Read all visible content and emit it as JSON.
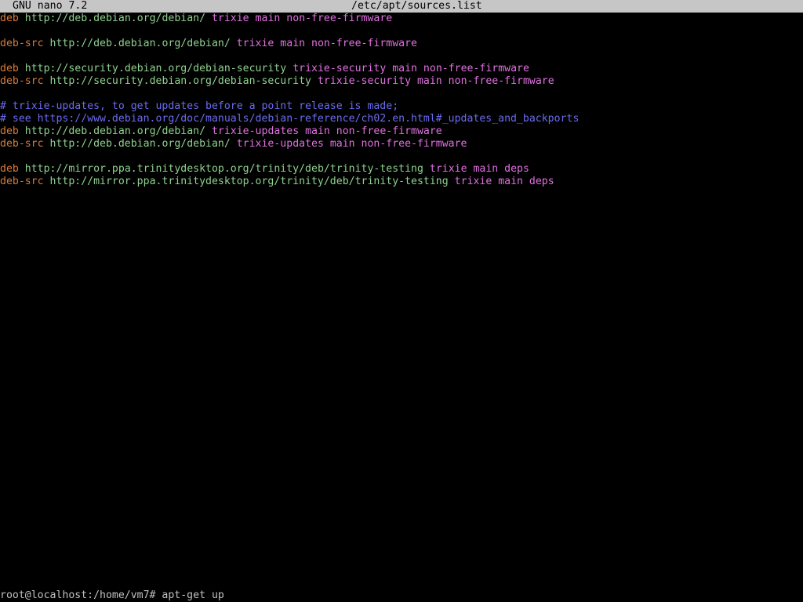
{
  "title_bar": {
    "app": "GNU nano 7.2",
    "file": "/etc/apt/sources.list"
  },
  "colors": {
    "keyword": "#d97a3a",
    "url": "#8fd18f",
    "suite": "#e070e0",
    "comment": "#6b6bf0",
    "background": "#000000",
    "title_bg": "#c6c6c6"
  },
  "lines": [
    {
      "type": "entry",
      "kw": "deb",
      "url": "http://deb.debian.org/debian/",
      "rest": "trixie main non-free-firmware"
    },
    {
      "type": "blank"
    },
    {
      "type": "entry",
      "kw": "deb-src",
      "url": "http://deb.debian.org/debian/",
      "rest": "trixie main non-free-firmware"
    },
    {
      "type": "blank"
    },
    {
      "type": "entry",
      "kw": "deb",
      "url": "http://security.debian.org/debian-security",
      "rest": "trixie-security main non-free-firmware"
    },
    {
      "type": "entry",
      "kw": "deb-src",
      "url": "http://security.debian.org/debian-security",
      "rest": "trixie-security main non-free-firmware"
    },
    {
      "type": "blank"
    },
    {
      "type": "comment",
      "text": "# trixie-updates, to get updates before a point release is made;"
    },
    {
      "type": "comment",
      "text": "# see https://www.debian.org/doc/manuals/debian-reference/ch02.en.html#_updates_and_backports"
    },
    {
      "type": "entry",
      "kw": "deb",
      "url": "http://deb.debian.org/debian/",
      "rest": "trixie-updates main non-free-firmware"
    },
    {
      "type": "entry",
      "kw": "deb-src",
      "url": "http://deb.debian.org/debian/",
      "rest": "trixie-updates main non-free-firmware"
    },
    {
      "type": "blank"
    },
    {
      "type": "entry",
      "kw": "deb",
      "url": "http://mirror.ppa.trinitydesktop.org/trinity/deb/trinity-testing",
      "rest": "trixie main deps"
    },
    {
      "type": "entry",
      "kw": "deb-src",
      "url": "http://mirror.ppa.trinitydesktop.org/trinity/deb/trinity-testing",
      "rest": "trixie main deps"
    }
  ],
  "shell_prompt": {
    "text": "root@localhost:/home/vm7# apt-get up"
  }
}
